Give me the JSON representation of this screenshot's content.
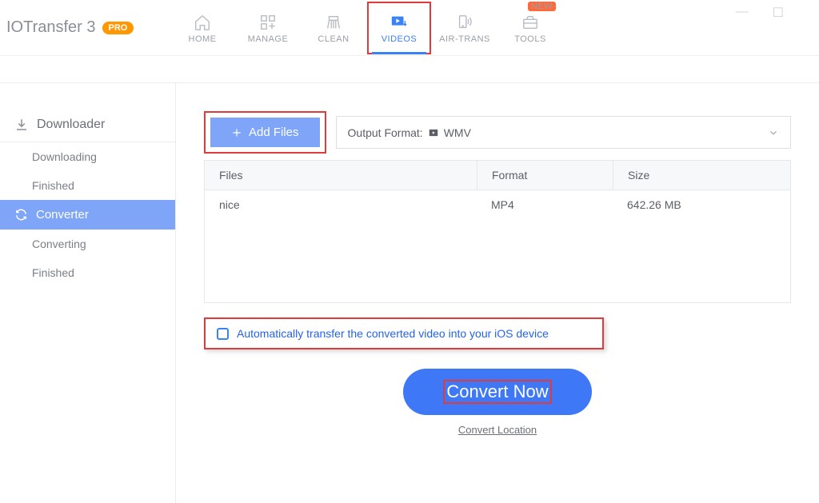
{
  "app": {
    "name": "IOTransfer 3",
    "badge": "PRO",
    "new_tag": "NEW"
  },
  "nav": {
    "home": "HOME",
    "manage": "MANAGE",
    "clean": "CLEAN",
    "videos": "VIDEOS",
    "airtrans": "AIR-TRANS",
    "tools": "TOOLS"
  },
  "sidebar": {
    "downloader": {
      "label": "Downloader",
      "downloading": "Downloading",
      "finished": "Finished"
    },
    "converter": {
      "label": "Converter",
      "converting": "Converting",
      "finished": "Finished"
    }
  },
  "toolbar": {
    "add_files": "Add Files",
    "output_format_label": "Output Format:",
    "output_format_value": "WMV"
  },
  "table": {
    "headers": {
      "files": "Files",
      "format": "Format",
      "size": "Size"
    },
    "rows": [
      {
        "file": "nice",
        "format": "MP4",
        "size": "642.26 MB"
      }
    ]
  },
  "auto_transfer": "Automatically transfer the converted video into your iOS device",
  "convert_now": "Convert Now",
  "convert_location": "Convert Location"
}
